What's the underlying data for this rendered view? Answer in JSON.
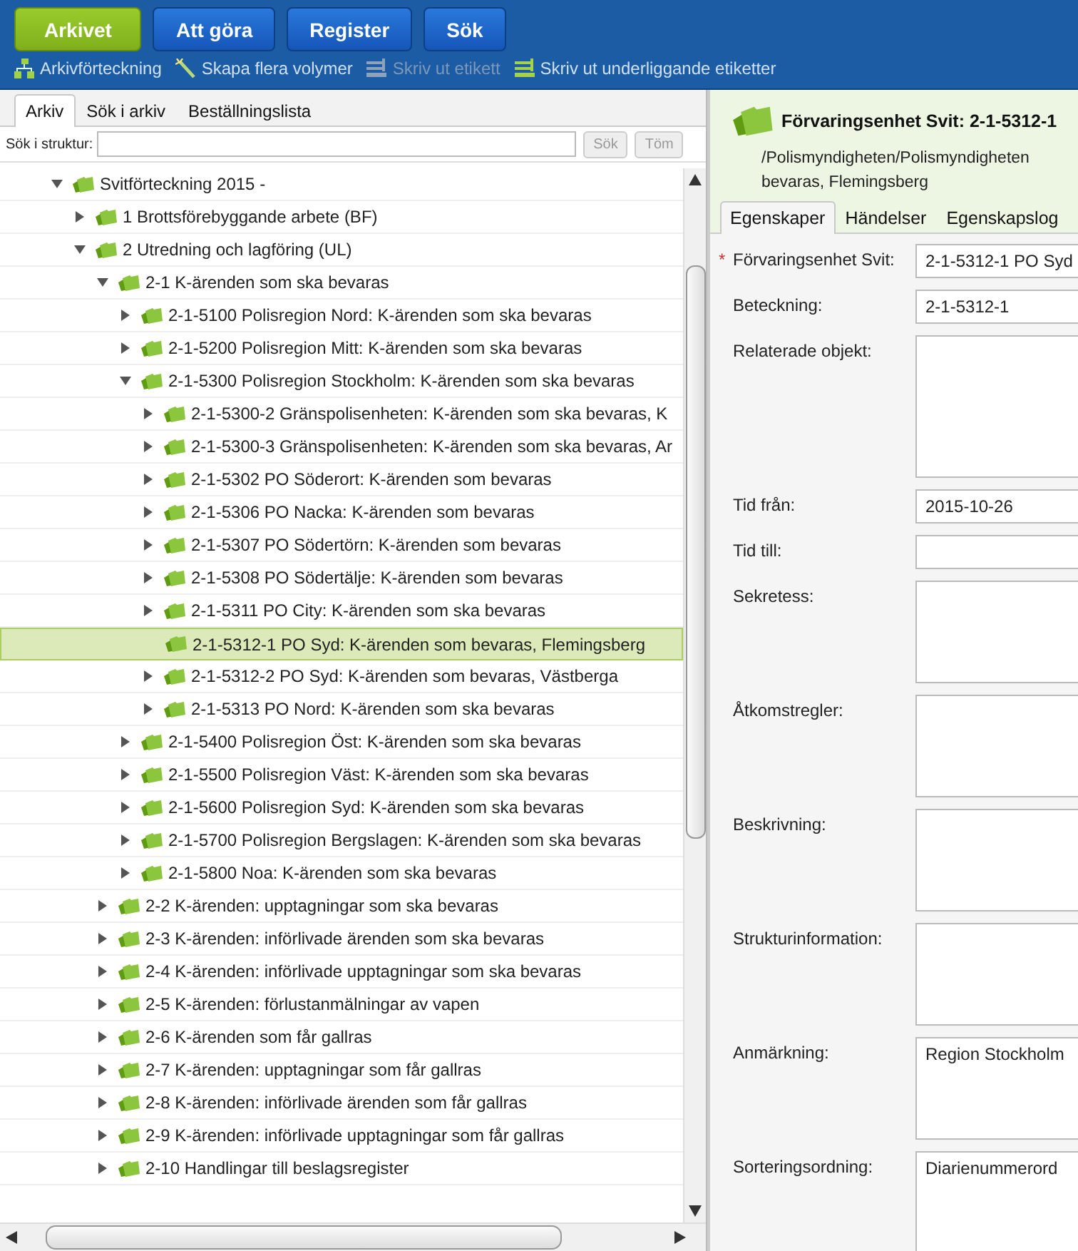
{
  "nav_buttons": [
    {
      "label": "Arkivet",
      "selected": true
    },
    {
      "label": "Att göra",
      "selected": false
    },
    {
      "label": "Register",
      "selected": false
    },
    {
      "label": "Sök",
      "selected": false
    }
  ],
  "toolbar": [
    {
      "label": "Arkivförteckning",
      "kind": "hierarchy",
      "disabled": false
    },
    {
      "label": "Skapa flera volymer",
      "kind": "wand",
      "disabled": false
    },
    {
      "label": "Skriv ut etikett",
      "kind": "label",
      "disabled": true
    },
    {
      "label": "Skriv ut underliggande etiketter",
      "kind": "labels",
      "disabled": false
    }
  ],
  "left_tabs": [
    {
      "label": "Arkiv",
      "selected": true
    },
    {
      "label": "Sök i arkiv",
      "selected": false
    },
    {
      "label": "Beställningslista",
      "selected": false
    }
  ],
  "structure_search": {
    "label": "Sök i struktur:",
    "buttons": [
      {
        "label": "Sök",
        "disabled": true
      },
      {
        "label": "Töm",
        "disabled": true
      }
    ]
  },
  "tree": [
    {
      "label": "Svitförteckning 2015 -",
      "kind": "branch",
      "expanded": true,
      "selected": false,
      "children": [
        {
          "label": "1 Brottsförebyggande arbete (BF)",
          "kind": "branch",
          "expanded": false,
          "selected": false
        },
        {
          "label": "2 Utredning och lagföring (UL)",
          "kind": "branch",
          "expanded": true,
          "selected": false,
          "children": [
            {
              "label": "2-1 K-ärenden som ska bevaras",
              "kind": "branch",
              "expanded": true,
              "selected": false,
              "children": [
                {
                  "label": "2-1-5100 Polisregion Nord: K-ärenden som ska bevaras",
                  "kind": "branch",
                  "expanded": false,
                  "selected": false
                },
                {
                  "label": "2-1-5200 Polisregion Mitt: K-ärenden som ska bevaras",
                  "kind": "branch",
                  "expanded": false,
                  "selected": false
                },
                {
                  "label": "2-1-5300 Polisregion Stockholm: K-ärenden som ska bevaras",
                  "kind": "branch",
                  "expanded": true,
                  "selected": false,
                  "children": [
                    {
                      "label": "2-1-5300-2 Gränspolisenheten: K-ärenden som ska bevaras, K",
                      "kind": "branch",
                      "expanded": false,
                      "selected": false
                    },
                    {
                      "label": "2-1-5300-3 Gränspolisenheten: K-ärenden som ska bevaras, Ar",
                      "kind": "branch",
                      "expanded": false,
                      "selected": false
                    },
                    {
                      "label": "2-1-5302 PO Söderort: K-ärenden som bevaras",
                      "kind": "branch",
                      "expanded": false,
                      "selected": false
                    },
                    {
                      "label": "2-1-5306 PO Nacka: K-ärenden som bevaras",
                      "kind": "branch",
                      "expanded": false,
                      "selected": false
                    },
                    {
                      "label": "2-1-5307 PO Södertörn: K-ärenden som bevaras",
                      "kind": "branch",
                      "expanded": false,
                      "selected": false
                    },
                    {
                      "label": "2-1-5308 PO Södertälje: K-ärenden som bevaras",
                      "kind": "branch",
                      "expanded": false,
                      "selected": false
                    },
                    {
                      "label": "2-1-5311 PO City: K-ärenden som ska bevaras",
                      "kind": "branch",
                      "expanded": false,
                      "selected": false
                    },
                    {
                      "label": "2-1-5312-1 PO Syd: K-ärenden som bevaras, Flemingsberg",
                      "kind": "leaf",
                      "selected": true
                    },
                    {
                      "label": "2-1-5312-2 PO Syd: K-ärenden som bevaras, Västberga",
                      "kind": "branch",
                      "expanded": false,
                      "selected": false
                    },
                    {
                      "label": "2-1-5313 PO Nord: K-ärenden som ska bevaras",
                      "kind": "branch",
                      "expanded": false,
                      "selected": false
                    }
                  ]
                },
                {
                  "label": "2-1-5400 Polisregion Öst: K-ärenden som ska bevaras",
                  "kind": "branch",
                  "expanded": false,
                  "selected": false
                },
                {
                  "label": "2-1-5500 Polisregion Väst: K-ärenden som ska bevaras",
                  "kind": "branch",
                  "expanded": false,
                  "selected": false
                },
                {
                  "label": "2-1-5600 Polisregion Syd: K-ärenden som ska bevaras",
                  "kind": "branch",
                  "expanded": false,
                  "selected": false
                },
                {
                  "label": "2-1-5700 Polisregion Bergslagen: K-ärenden som ska bevaras",
                  "kind": "branch",
                  "expanded": false,
                  "selected": false
                },
                {
                  "label": "2-1-5800 Noa: K-ärenden som ska bevaras",
                  "kind": "branch",
                  "expanded": false,
                  "selected": false
                }
              ]
            },
            {
              "label": "2-2 K-ärenden: upptagningar som ska bevaras",
              "kind": "branch",
              "expanded": false,
              "selected": false
            },
            {
              "label": "2-3 K-ärenden: införlivade ärenden som ska bevaras",
              "kind": "branch",
              "expanded": false,
              "selected": false
            },
            {
              "label": "2-4 K-ärenden: införlivade upptagningar som ska bevaras",
              "kind": "branch",
              "expanded": false,
              "selected": false
            },
            {
              "label": "2-5 K-ärenden: förlustanmälningar av vapen",
              "kind": "branch",
              "expanded": false,
              "selected": false
            },
            {
              "label": "2-6 K-ärenden som får gallras",
              "kind": "branch",
              "expanded": false,
              "selected": false
            },
            {
              "label": "2-7 K-ärenden: upptagningar som får gallras",
              "kind": "branch",
              "expanded": false,
              "selected": false
            },
            {
              "label": "2-8 K-ärenden: införlivade ärenden som får gallras",
              "kind": "branch",
              "expanded": false,
              "selected": false
            },
            {
              "label": "2-9 K-ärenden: införlivade upptagningar som får gallras",
              "kind": "branch",
              "expanded": false,
              "selected": false
            },
            {
              "label": "2-10 Handlingar till beslagsregister",
              "kind": "branch",
              "expanded": false,
              "selected": false
            }
          ]
        }
      ]
    }
  ],
  "detail": {
    "title": "Förvaringsenhet Svit: 2-1-5312-1",
    "path_lines": [
      "/Polismyndigheten/Polismyndigheten",
      "bevaras, Flemingsberg"
    ],
    "tabs": [
      {
        "label": "Egenskaper",
        "selected": true
      },
      {
        "label": "Händelser",
        "selected": false
      },
      {
        "label": "Egenskapslog",
        "selected": false
      }
    ],
    "fields": [
      {
        "label": "Förvaringsenhet Svit:",
        "kind": "input",
        "required_mark": "*",
        "value": "2-1-5312-1 PO Syd"
      },
      {
        "label": "Beteckning:",
        "kind": "input",
        "value": "2-1-5312-1"
      },
      {
        "label": "Relaterade objekt:",
        "kind": "list"
      },
      {
        "label": "Tid från:",
        "kind": "input",
        "value": "2015-10-26"
      },
      {
        "label": "Tid till:",
        "kind": "input"
      },
      {
        "label": "Sekretess:",
        "kind": "textarea"
      },
      {
        "label": "Åtkomstregler:",
        "kind": "textarea"
      },
      {
        "label": "Beskrivning:",
        "kind": "textarea"
      },
      {
        "label": "Strukturinformation:",
        "kind": "textarea"
      },
      {
        "label": "Anmärkning:",
        "kind": "textarea",
        "value": "Region Stockholm"
      },
      {
        "label": "Sorteringsordning:",
        "kind": "textarea",
        "value": "Diarienummerord"
      }
    ]
  }
}
